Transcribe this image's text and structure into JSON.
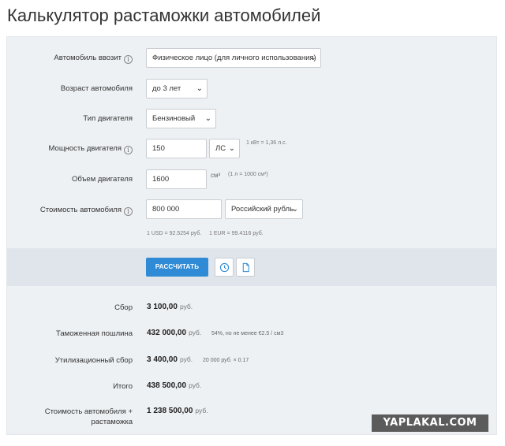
{
  "page": {
    "title": "Калькулятор растаможки автомобилей"
  },
  "form": {
    "importer": {
      "label": "Автомобиль ввозит",
      "value": "Физическое лицо (для личного использования)"
    },
    "age": {
      "label": "Возраст автомобиля",
      "value": "до 3 лет"
    },
    "engine_type": {
      "label": "Тип двигателя",
      "value": "Бензиновый"
    },
    "power": {
      "label": "Мощность двигателя",
      "value": "150",
      "unit": "ЛС",
      "hint": "1 кВт = 1,36 л.с."
    },
    "volume": {
      "label": "Объем двигателя",
      "value": "1600",
      "unit": "см³",
      "hint": "(1 л = 1000 см³)"
    },
    "price": {
      "label": "Стоимость автомобиля",
      "value": "800 000",
      "currency": "Российский рубль"
    },
    "rates": {
      "usd": "1 USD = 92.5254 руб.",
      "eur": "1 EUR = 99.4116 руб."
    }
  },
  "actions": {
    "calculate_label": "РАССЧИТАТЬ",
    "history_icon": "clock-icon",
    "document_icon": "document-icon"
  },
  "results": {
    "currency": "руб.",
    "rows": [
      {
        "label": "Сбор",
        "value": "3 100,00",
        "note": ""
      },
      {
        "label": "Таможенная пошлина",
        "value": "432 000,00",
        "note": "54%, но не менее €2.5 / см3"
      },
      {
        "label": "Утилизационный сбор",
        "value": "3 400,00",
        "note": "20 000 руб. × 0.17"
      },
      {
        "label": "Итого",
        "value": "438 500,00",
        "note": ""
      },
      {
        "label": "Стоимость автомобиля + растаможка",
        "value": "1 238 500,00",
        "note": ""
      }
    ]
  },
  "watermark": {
    "text": "YAPLAKAL.COM"
  },
  "colors": {
    "accent": "#2f8bd6",
    "panel": "#eef1f4",
    "panel_action": "#dfe5ea"
  }
}
